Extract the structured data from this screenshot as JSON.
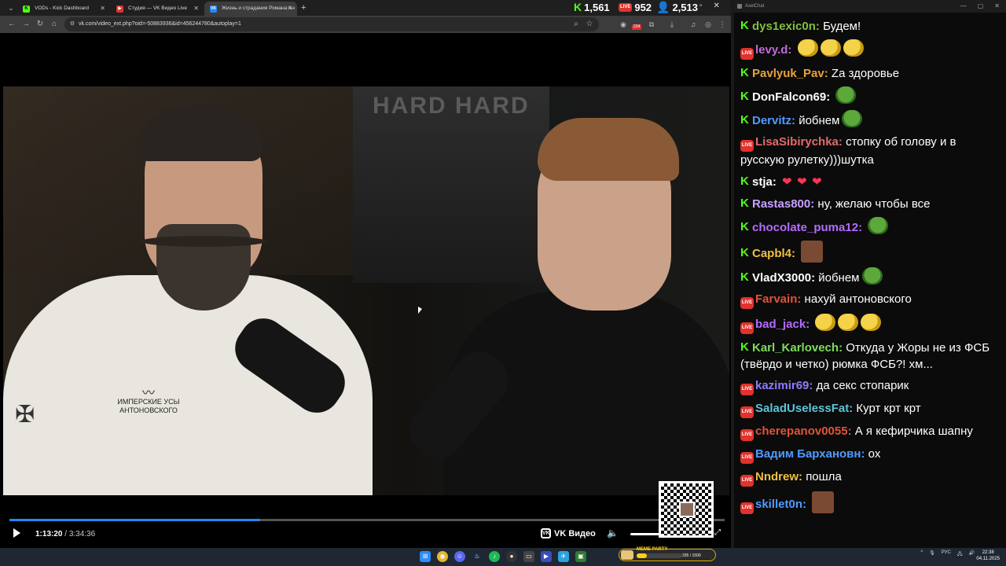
{
  "browser": {
    "tabs": [
      {
        "label": "VODs - Kick Dashboard",
        "fav_color": "#53fc18",
        "fav_text": "K"
      },
      {
        "label": "Студия — VK Видео Live",
        "fav_color": "#e1322c",
        "fav_text": "▶"
      },
      {
        "label": "Жизнь и страдания Романа Ан",
        "fav_color": "#2787f5",
        "fav_text": "VK"
      }
    ],
    "url": "vk.com/video_ext.php?oid=-50883936&id=456244780&autoplay=1",
    "stats": {
      "kick_viewers": "1,561",
      "vk_viewers": "952",
      "total_viewers": "2,513",
      "live_label": "LIVE"
    },
    "extension_badge": "234"
  },
  "video": {
    "poster_text": "HARD HARD",
    "shirt_logo_line1": "ИМПЕРСКИЕ УСЫ",
    "shirt_logo_line2": "АНТОНОВСКОГО",
    "progress_fraction": 0.35,
    "time_current": "1:13:20",
    "time_separator": "/",
    "time_total": "3:34:36",
    "brand": "VK Видео",
    "brand_mark": "VK"
  },
  "chat": {
    "window_title": "AxelChat",
    "messages": [
      {
        "platform": "kick",
        "user": "dys1exic0n",
        "color": "#7fbf3f",
        "text": "Будем!",
        "emotes": []
      },
      {
        "platform": "vk",
        "user": "levy.d",
        "color": "#c26bd9",
        "text": "",
        "emotes": [
          "cheese",
          "cheese",
          "cheese"
        ]
      },
      {
        "platform": "kick",
        "user": "Pavlyuk_Pav",
        "color": "#e8a33a",
        "text": "Za здоровье",
        "emotes": []
      },
      {
        "platform": "kick",
        "user": "DonFalcon69",
        "color": "#ffffff",
        "text": "",
        "emotes": [
          "pepe"
        ]
      },
      {
        "platform": "kick",
        "user": "Dervitz",
        "color": "#4f9bff",
        "text": "йобнем",
        "emotes": [
          "pepe"
        ]
      },
      {
        "platform": "vk",
        "user": "LisaSibirychka",
        "color": "#e56a6a",
        "text": "стопку об голову и в русскую рулетку)))шутка",
        "emotes": []
      },
      {
        "platform": "kick",
        "user": "stja",
        "color": "#ffffff",
        "text": "",
        "emotes": [
          "heart",
          "heart",
          "heart"
        ]
      },
      {
        "platform": "kick",
        "user": "Rastas800",
        "color": "#c8a0ff",
        "text": "ну, желаю чтобы все",
        "emotes": []
      },
      {
        "platform": "kick",
        "user": "chocolate_puma12",
        "color": "#b46bff",
        "text": "",
        "emotes": [
          "pepe"
        ]
      },
      {
        "platform": "kick",
        "user": "Capbl4",
        "color": "#f0c040",
        "text": "",
        "emotes": [
          "face"
        ]
      },
      {
        "platform": "kick",
        "user": "VladX3000",
        "color": "#ffffff",
        "text": "йобнем",
        "emotes": [
          "pepe"
        ]
      },
      {
        "platform": "vk",
        "user": "Farvain",
        "color": "#e0533a",
        "text": "нахуй антоновского",
        "emotes": []
      },
      {
        "platform": "vk",
        "user": "bad_jack",
        "color": "#b46bff",
        "text": "",
        "emotes": [
          "cheese",
          "cheese",
          "cheese"
        ]
      },
      {
        "platform": "kick",
        "user": "Karl_Karlovech",
        "color": "#7fdc5a",
        "text": "Откуда у Жоры не из ФСБ (твёрдо и четко) рюмка ФСБ?! хм...",
        "emotes": []
      },
      {
        "platform": "vk",
        "user": "kazimir69",
        "color": "#8e7bff",
        "text": "да секс стопарик",
        "emotes": []
      },
      {
        "platform": "vk",
        "user": "SaladUselessFat",
        "color": "#5ec4d6",
        "text": "Курт крт крт",
        "emotes": []
      },
      {
        "platform": "vk",
        "user": "cherepanov0055",
        "color": "#e0533a",
        "text": "А я кефирчика шапну",
        "emotes": []
      },
      {
        "platform": "vk",
        "user": "Вадим Бархановн",
        "color": "#4f9bff",
        "text": "ох",
        "emotes": []
      },
      {
        "platform": "vk",
        "user": "Nndrew",
        "color": "#f0c040",
        "text": "пошла",
        "emotes": []
      },
      {
        "platform": "vk",
        "user": "skillet0n",
        "color": "#4f9bff",
        "text": "",
        "emotes": [
          "face"
        ]
      }
    ]
  },
  "taskbar": {
    "meme_title": "MEME PARTY",
    "meme_count": "335 / 1500",
    "meme_fraction": 0.22,
    "lang": "РУС",
    "time": "22:38",
    "date": "04.11.2025"
  }
}
